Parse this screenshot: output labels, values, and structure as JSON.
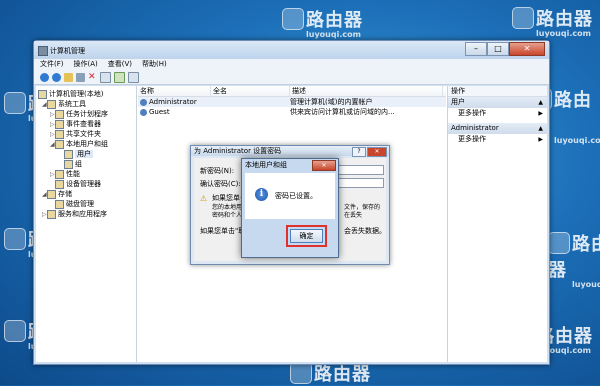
{
  "watermark": {
    "brand_text": "路由器",
    "url_text": "luyouqi.com"
  },
  "window": {
    "title": "计算机管理",
    "controls": {
      "minimize": "–",
      "maximize": "□",
      "close": "✕"
    },
    "menu": [
      "文件(F)",
      "操作(A)",
      "查看(V)",
      "帮助(H)"
    ],
    "toolbar_icons": [
      "back-icon",
      "forward-icon",
      "folder-icon",
      "view-icon",
      "delete-icon",
      "properties-icon",
      "export-icon",
      "help-icon"
    ]
  },
  "tree": [
    {
      "label": "计算机管理(本地)",
      "indent": 0,
      "exp": ""
    },
    {
      "label": "系统工具",
      "indent": 1,
      "exp": "◢"
    },
    {
      "label": "任务计划程序",
      "indent": 2,
      "exp": "▷"
    },
    {
      "label": "事件查看器",
      "indent": 2,
      "exp": "▷"
    },
    {
      "label": "共享文件夹",
      "indent": 2,
      "exp": "▷"
    },
    {
      "label": "本地用户和组",
      "indent": 2,
      "exp": "◢"
    },
    {
      "label": "用户",
      "indent": 3,
      "exp": ""
    },
    {
      "label": "组",
      "indent": 3,
      "exp": ""
    },
    {
      "label": "性能",
      "indent": 2,
      "exp": "▷"
    },
    {
      "label": "设备管理器",
      "indent": 2,
      "exp": ""
    },
    {
      "label": "存储",
      "indent": 1,
      "exp": "◢"
    },
    {
      "label": "磁盘管理",
      "indent": 2,
      "exp": ""
    },
    {
      "label": "服务和应用程序",
      "indent": 1,
      "exp": "▷"
    }
  ],
  "list": {
    "headers": [
      "名称",
      "全名",
      "描述"
    ],
    "rows": [
      {
        "name": "Administrator",
        "fullname": "",
        "desc": "管理计算机(域)的内置帐户"
      },
      {
        "name": "Guest",
        "fullname": "",
        "desc": "供来宾访问计算机或访问域的内..."
      }
    ]
  },
  "actions": {
    "header": "操作",
    "sections": [
      {
        "title": "用户",
        "item": "更多操作"
      },
      {
        "title": "Administrator",
        "item": "更多操作"
      }
    ]
  },
  "set_password_dialog": {
    "title": "为 Administrator 设置密码",
    "help": "?",
    "close": "✕",
    "new_password_label": "新密码(N):",
    "confirm_password_label": "确认密码(C):",
    "warning_lines": [
      "如果您单击",
      "您的本地用户",
      "密码和个人"
    ],
    "warning_tail": [
      "文件，保存的",
      "在丢失"
    ],
    "footer_left": "如果您单击\"取",
    "footer_right": "会丢失数据。",
    "ok": "确定",
    "cancel": "取消"
  },
  "confirm_dialog": {
    "title": "本地用户和组",
    "close": "✕",
    "message": "密码已设置。",
    "ok": "确定"
  }
}
